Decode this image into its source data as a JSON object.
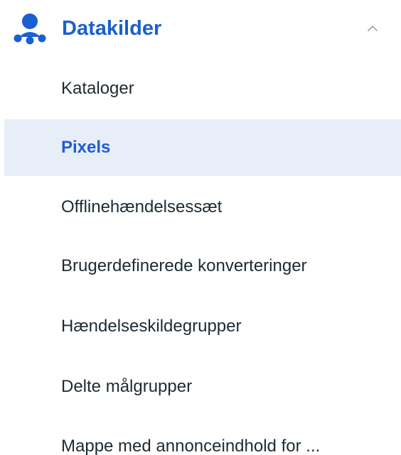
{
  "section": {
    "title": "Datakilder",
    "icon": "data-sources-icon",
    "expanded": true,
    "accent_color": "#1a5fd0"
  },
  "nav": {
    "items": [
      {
        "label": "Kataloger",
        "active": false
      },
      {
        "label": "Pixels",
        "active": true
      },
      {
        "label": "Offlinehændelsessæt",
        "active": false
      },
      {
        "label": "Brugerdefinerede konverteringer",
        "active": false
      },
      {
        "label": "Hændelseskildegrupper",
        "active": false
      },
      {
        "label": "Delte målgrupper",
        "active": false
      },
      {
        "label": "Mappe med annonceindhold for ...",
        "active": false
      }
    ]
  }
}
